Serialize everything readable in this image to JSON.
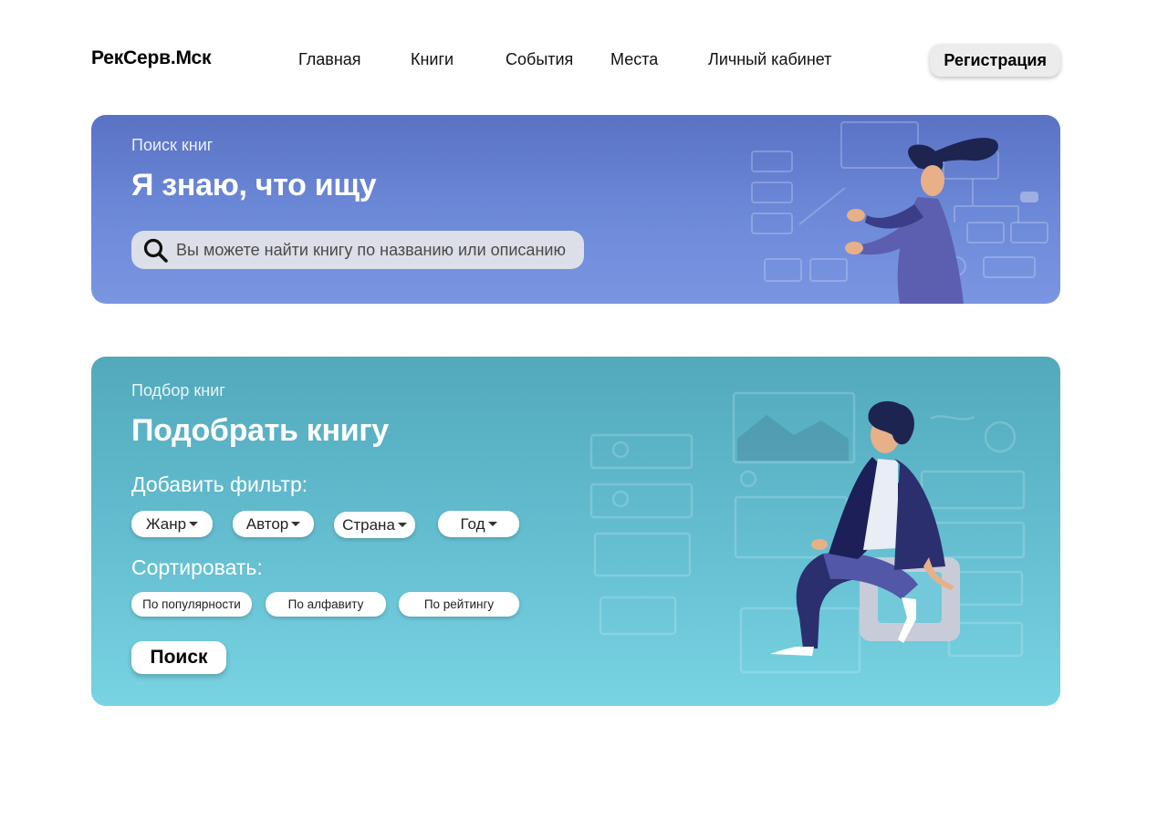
{
  "brand": {
    "logo": "РекСерв.Мск"
  },
  "nav": {
    "items": [
      {
        "label": "Главная"
      },
      {
        "label": "Книги"
      },
      {
        "label": "События"
      },
      {
        "label": "Места"
      },
      {
        "label": "Личный кабинет"
      }
    ],
    "register_label": "Регистрация"
  },
  "search_card": {
    "eyebrow": "Поиск книг",
    "title": "Я знаю, что ищу",
    "search": {
      "placeholder": "Вы можете найти книгу по названию или описанию",
      "value": ""
    },
    "icon": "search-icon"
  },
  "pick_card": {
    "eyebrow": "Подбор книг",
    "title": "Подобрать книгу",
    "filter_label": "Добавить фильтр:",
    "filters": [
      {
        "label": "Жанр"
      },
      {
        "label": "Автор"
      },
      {
        "label": "Страна"
      },
      {
        "label": "Год"
      }
    ],
    "sort_label": "Сортировать:",
    "sorts": [
      {
        "label": "По популярности"
      },
      {
        "label": "По алфавиту"
      },
      {
        "label": "По рейтингу"
      }
    ],
    "search_button": "Поиск"
  },
  "colors": {
    "search_card_top": "#5a72c4",
    "search_card_bottom": "#7a96e2",
    "pick_card_top": "#52a9bc",
    "pick_card_bottom": "#78d3e2",
    "register_bg": "#ececec"
  }
}
